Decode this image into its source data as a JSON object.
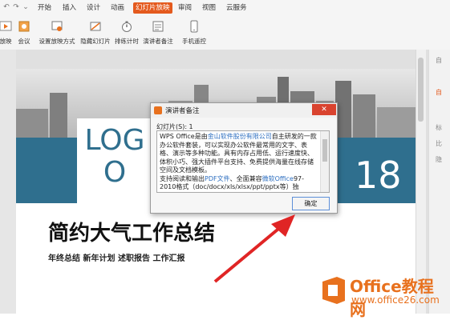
{
  "menu": {
    "items": [
      {
        "label": "开始"
      },
      {
        "label": "插入"
      },
      {
        "label": "设计"
      },
      {
        "label": "动画"
      },
      {
        "label": "幻灯片放映",
        "active": true
      },
      {
        "label": "审阅"
      },
      {
        "label": "视图"
      },
      {
        "label": "云服务"
      }
    ]
  },
  "ribbon": {
    "buttons": [
      {
        "label": "放映",
        "icon": "play-icon"
      },
      {
        "label": "会议",
        "icon": "meeting-icon"
      },
      {
        "label": "设置放映方式",
        "icon": "settings-icon"
      },
      {
        "label": "隐藏幻灯片",
        "icon": "hide-slide-icon"
      },
      {
        "label": "排练计时",
        "icon": "timer-icon"
      },
      {
        "label": "演讲者备注",
        "icon": "notes-icon"
      },
      {
        "label": "手机遥控",
        "icon": "phone-icon"
      }
    ]
  },
  "slide": {
    "logo": "LOG\nO",
    "year": "18",
    "title": "简约大气工作总结",
    "subtitle": "年终总结 新年计划 述职报告 工作汇报"
  },
  "dialog": {
    "title": "演讲者备注",
    "close_label": "✕",
    "slide_number_label": "幻灯片(S): 1",
    "notes": {
      "p1_a": "WPS Office是由",
      "p1_link": "金山软件股份有限公司",
      "p1_b": "自主研发的一款办公软件套装，可以实现办公软件最常用的文字、表格、演示等多种功能。具有内存占用低、运行速度快、体积小巧、强大插件平台支持、免费提供海量在线存储空间及文档模板。",
      "p2_a": "支持阅读和输出",
      "p2_link1": "PDF文件",
      "p2_b": "、全面兼容",
      "p2_link2": "微软Office",
      "p2_c": "97-2010格式（doc/docx/xls/xlsx/ppt/pptx等）独"
    },
    "ok_label": "确定"
  },
  "right_panel": {
    "labels": [
      "自",
      "自",
      "标",
      "比",
      "隐"
    ]
  },
  "watermark": {
    "brand": "Office教程网",
    "url": "www.office26.com"
  },
  "colors": {
    "accent": "#e45a1e",
    "slide_blue": "#2f6f8e",
    "link": "#2e6fc0",
    "arrow": "#e02525"
  }
}
